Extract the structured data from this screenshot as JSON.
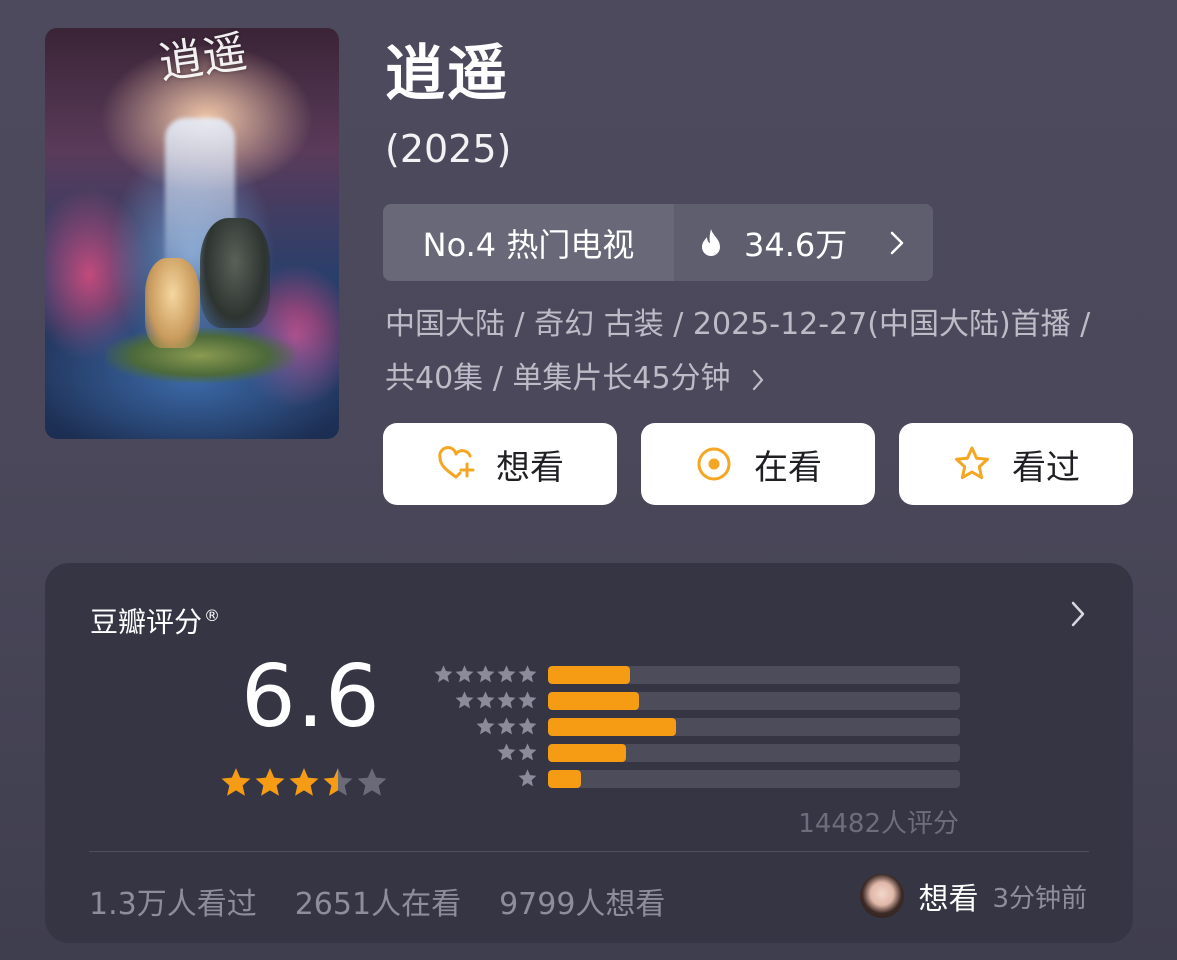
{
  "movie": {
    "title": "逍遥",
    "year": "(2025)",
    "poster_calligraphy": "逍遥"
  },
  "ranking": {
    "rank_label": "No.4 热门电视",
    "heat": "34.6万"
  },
  "meta": {
    "line1": "中国大陆 / 奇幻 古装 / 2025-12-27(中国大陆)首播 /",
    "line2": "共40集 / 单集片长45分钟"
  },
  "actions": {
    "want": "想看",
    "watching": "在看",
    "watched": "看过"
  },
  "rating": {
    "title": "豆瓣评分",
    "registered": "®",
    "score": "6.6",
    "stars_value": 3.5,
    "count_label": "14482人评分",
    "distribution": [
      {
        "stars": 5,
        "fraction": 0.2
      },
      {
        "stars": 4,
        "fraction": 0.22
      },
      {
        "stars": 3,
        "fraction": 0.31
      },
      {
        "stars": 2,
        "fraction": 0.19
      },
      {
        "stars": 1,
        "fraction": 0.08
      }
    ]
  },
  "stats": {
    "watched": "1.3万人看过",
    "watching": "2651人在看",
    "want": "9799人想看"
  },
  "friend": {
    "action": "想看",
    "time": "3分钟前"
  },
  "colors": {
    "accent": "#f59c14",
    "card_bg": "#363544",
    "page_bg": "#4a485a"
  }
}
